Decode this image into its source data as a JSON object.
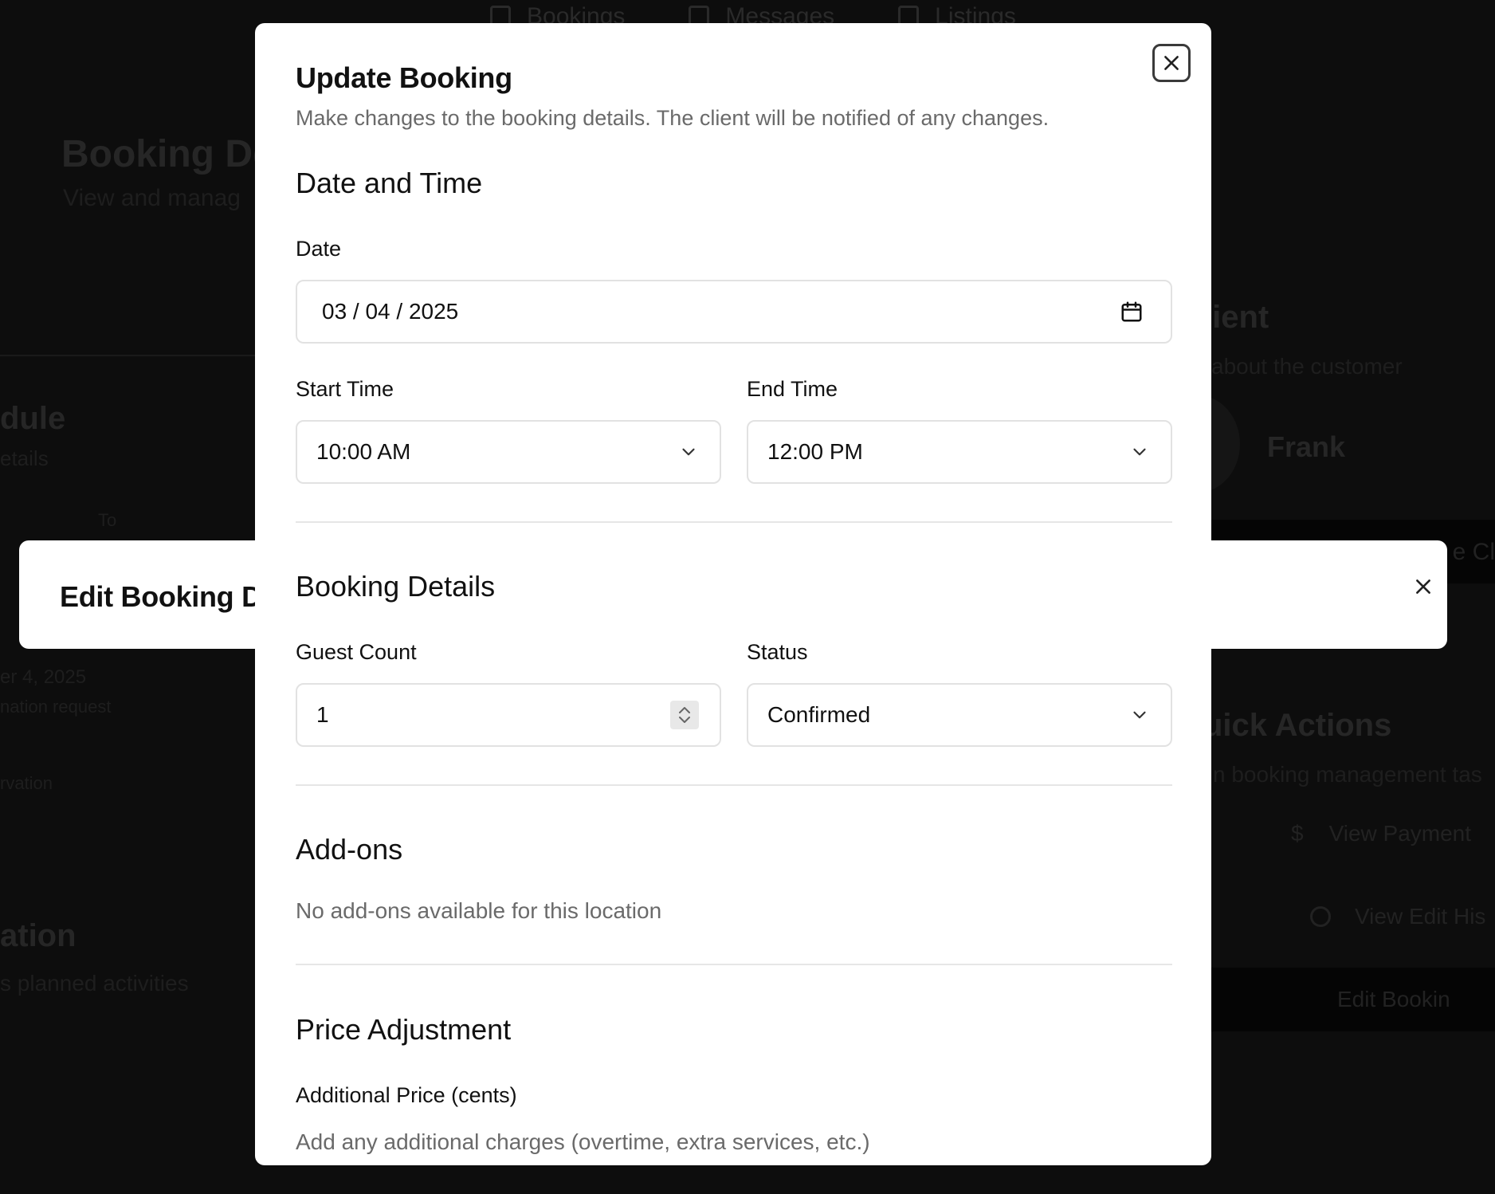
{
  "background": {
    "nav": [
      "Bookings",
      "Messages",
      "Listings"
    ],
    "page_title": "Booking De",
    "page_subtitle": "View and manag",
    "schedule_title": "dule",
    "schedule_sub": "etails",
    "to_label": "To",
    "date_line": "er 4, 2025",
    "date_line2": "nation request",
    "date_line3": "rvation",
    "location_title": "ation",
    "location_sub": "s planned activities",
    "client_title": "lient",
    "client_sub": "about the customer",
    "client_name": "Frank",
    "client_button": "e Cl",
    "quick_actions_title": "uick Actions",
    "quick_actions_sub": "n booking management tas",
    "view_payment": "View Payment",
    "view_edit_history": "View Edit His",
    "edit_booking": "Edit Bookin"
  },
  "middle_dialog": {
    "title": "Edit Booking De"
  },
  "modal": {
    "title": "Update Booking",
    "description": "Make changes to the booking details. The client will be notified of any changes.",
    "date_time_section": "Date and Time",
    "date_label": "Date",
    "date_value": "03 / 04 / 2025",
    "start_time_label": "Start Time",
    "start_time_value": "10:00 AM",
    "end_time_label": "End Time",
    "end_time_value": "12:00 PM",
    "booking_details_section": "Booking Details",
    "guest_count_label": "Guest Count",
    "guest_count_value": "1",
    "status_label": "Status",
    "status_value": "Confirmed",
    "addons_section": "Add-ons",
    "addons_empty": "No add-ons available for this location",
    "price_section": "Price Adjustment",
    "additional_price_label": "Additional Price (cents)",
    "additional_price_help": "Add any additional charges (overtime, extra services, etc.)"
  },
  "icons": {
    "close": "close-icon",
    "calendar": "calendar-icon",
    "chevron": "chevron-down-icon",
    "stepper": "stepper-icon"
  }
}
